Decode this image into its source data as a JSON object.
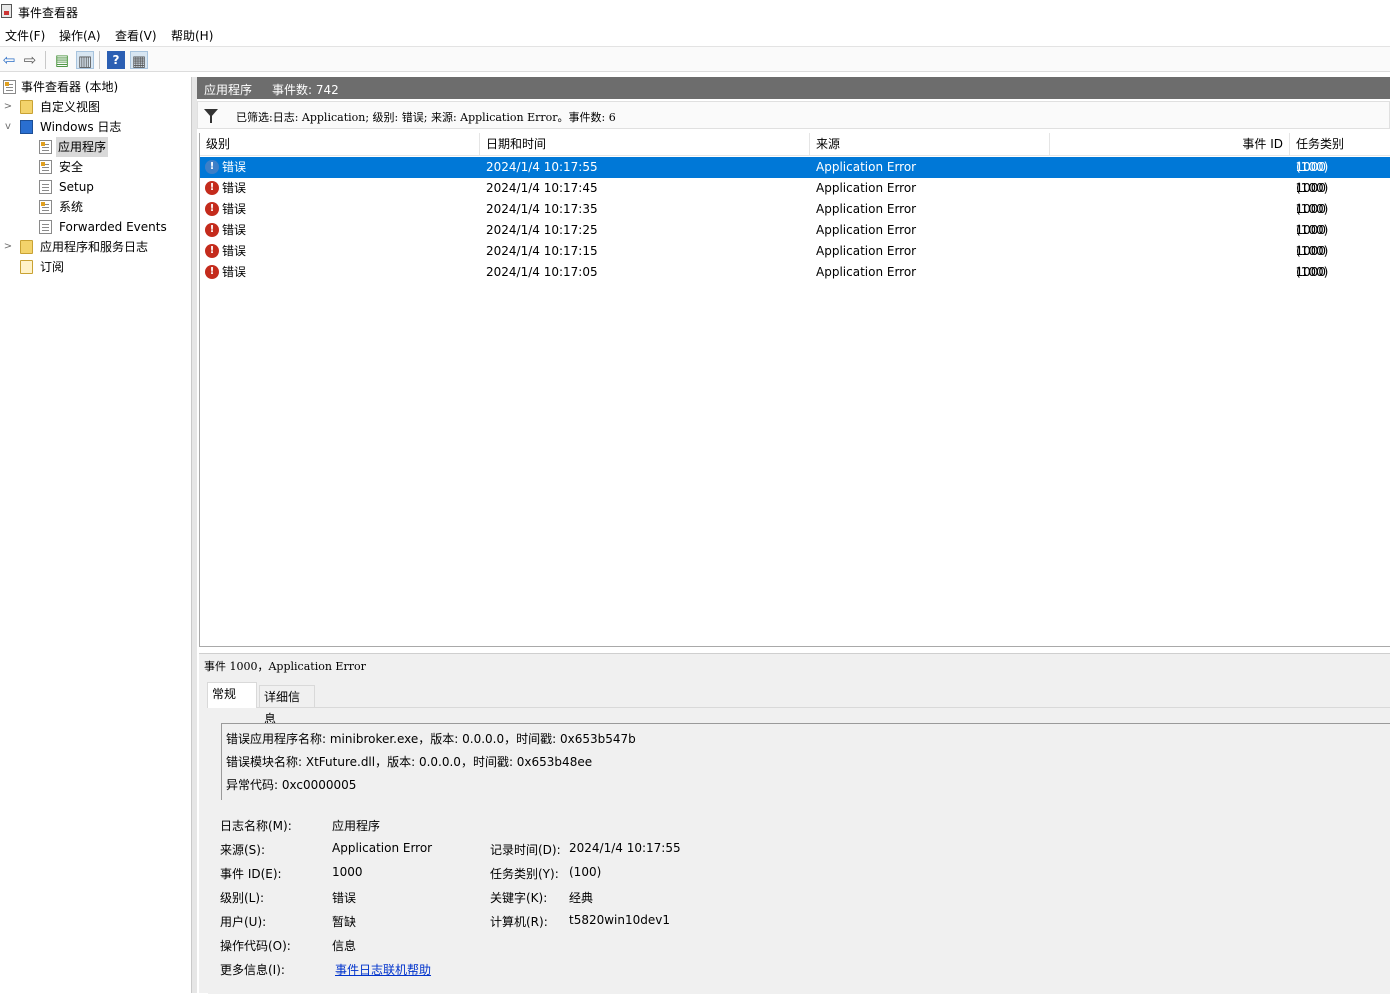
{
  "window": {
    "title": "事件查看器"
  },
  "menu": [
    "文件(F)",
    "操作(A)",
    "查看(V)",
    "帮助(H)"
  ],
  "toolbar": {
    "back_icon": "back-arrow-icon",
    "forward_icon": "forward-arrow-icon",
    "up_icon": "folder-up-icon",
    "console_icon": "console-tree-icon",
    "help_icon": "help-icon",
    "action_pane_icon": "action-pane-icon"
  },
  "tree": {
    "root": "事件查看器 (本地)",
    "custom_views": "自定义视图",
    "windows_logs": "Windows 日志",
    "logs": [
      "应用程序",
      "安全",
      "Setup",
      "系统",
      "Forwarded Events"
    ],
    "app_service_logs": "应用程序和服务日志",
    "subscriptions": "订阅"
  },
  "panel": {
    "title": "应用程序",
    "count": "事件数: 742"
  },
  "filter": {
    "text": "已筛选:日志: Application; 级别: 错误; 来源: Application Error。事件数: 6"
  },
  "columns": {
    "level": "级别",
    "datetime": "日期和时间",
    "source": "来源",
    "event_id": "事件 ID",
    "task": "任务类别"
  },
  "rows": [
    {
      "level": "错误",
      "datetime": "2024/1/4 10:17:55",
      "source": "Application Error",
      "event_id": "1000",
      "task": "(100)"
    },
    {
      "level": "错误",
      "datetime": "2024/1/4 10:17:45",
      "source": "Application Error",
      "event_id": "1000",
      "task": "(100)"
    },
    {
      "level": "错误",
      "datetime": "2024/1/4 10:17:35",
      "source": "Application Error",
      "event_id": "1000",
      "task": "(100)"
    },
    {
      "level": "错误",
      "datetime": "2024/1/4 10:17:25",
      "source": "Application Error",
      "event_id": "1000",
      "task": "(100)"
    },
    {
      "level": "错误",
      "datetime": "2024/1/4 10:17:15",
      "source": "Application Error",
      "event_id": "1000",
      "task": "(100)"
    },
    {
      "level": "错误",
      "datetime": "2024/1/4 10:17:05",
      "source": "Application Error",
      "event_id": "1000",
      "task": "(100)"
    }
  ],
  "detail": {
    "header": "事件 1000，Application Error",
    "tabs": {
      "general": "常规",
      "details": "详细信息"
    },
    "message": [
      "错误应用程序名称: minibroker.exe，版本: 0.0.0.0，时间戳: 0x653b547b",
      "错误模块名称: XtFuture.dll，版本: 0.0.0.0，时间戳: 0x653b48ee",
      "异常代码: 0xc0000005"
    ],
    "fields": {
      "log_name_label": "日志名称(M):",
      "log_name": "应用程序",
      "source_label": "来源(S):",
      "source": "Application Error",
      "logged_label": "记录时间(D):",
      "logged": "2024/1/4 10:17:55",
      "event_id_label": "事件 ID(E):",
      "event_id": "1000",
      "task_label": "任务类别(Y):",
      "task": "(100)",
      "level_label": "级别(L):",
      "level": "错误",
      "keywords_label": "关键字(K):",
      "keywords": "经典",
      "user_label": "用户(U):",
      "user": "暂缺",
      "computer_label": "计算机(R):",
      "computer": "t5820win10dev1",
      "opcode_label": "操作代码(O):",
      "opcode": "信息",
      "more_info_label": "更多信息(I):",
      "more_info_link": "事件日志联机帮助"
    }
  }
}
